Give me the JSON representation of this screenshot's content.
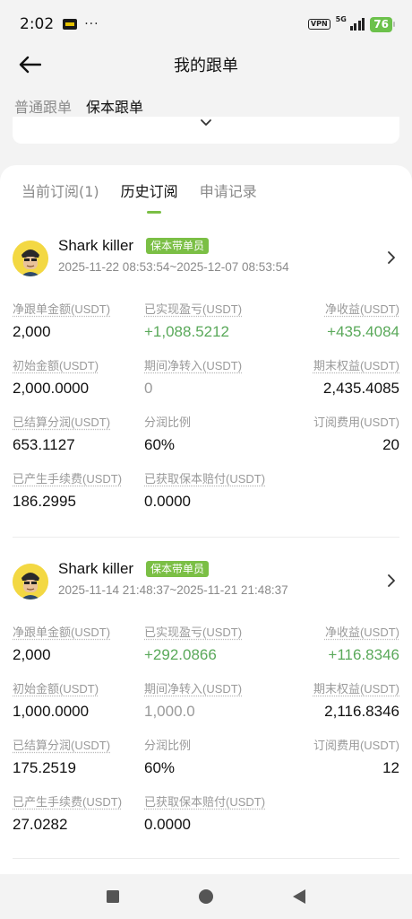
{
  "status_bar": {
    "time": "2:02",
    "dots": "···",
    "vpn": "VPN",
    "network": "5G",
    "battery": "76"
  },
  "header": {
    "title": "我的跟单"
  },
  "mode_tabs": [
    {
      "label": "普通跟单",
      "active": false
    },
    {
      "label": "保本跟单",
      "active": true
    }
  ],
  "sub_tabs": [
    {
      "label": "当前订阅(1)",
      "active": false
    },
    {
      "label": "历史订阅",
      "active": true
    },
    {
      "label": "申请记录",
      "active": false
    }
  ],
  "records": [
    {
      "name": "Shark killer",
      "badge": "保本带单员",
      "period": "2025-11-22 08:53:54~2025-12-07 08:53:54",
      "stats": {
        "net_follow_amount": {
          "label": "净跟单金额(USDT)",
          "value": "2,000"
        },
        "realized_pnl": {
          "label": "已实现盈亏(USDT)",
          "value": "+1,088.5212"
        },
        "net_profit": {
          "label": "净收益(USDT)",
          "value": "+435.4084"
        },
        "initial_amount": {
          "label": "初始金额(USDT)",
          "value": "2,000.0000"
        },
        "net_transfer": {
          "label": "期间净转入(USDT)",
          "value": "0"
        },
        "final_equity": {
          "label": "期末权益(USDT)",
          "value": "2,435.4085"
        },
        "settled_share": {
          "label": "已结算分润(USDT)",
          "value": "653.1127"
        },
        "share_ratio": {
          "label": "分润比例",
          "value": "60%"
        },
        "subscription_fee": {
          "label": "订阅费用(USDT)",
          "value": "20"
        },
        "fees": {
          "label": "已产生手续费(USDT)",
          "value": "186.2995"
        },
        "compensation": {
          "label": "已获取保本赔付(USDT)",
          "value": "0.0000"
        }
      }
    },
    {
      "name": "Shark killer",
      "badge": "保本带单员",
      "period": "2025-11-14 21:48:37~2025-11-21 21:48:37",
      "stats": {
        "net_follow_amount": {
          "label": "净跟单金额(USDT)",
          "value": "2,000"
        },
        "realized_pnl": {
          "label": "已实现盈亏(USDT)",
          "value": "+292.0866"
        },
        "net_profit": {
          "label": "净收益(USDT)",
          "value": "+116.8346"
        },
        "initial_amount": {
          "label": "初始金额(USDT)",
          "value": "1,000.0000"
        },
        "net_transfer": {
          "label": "期间净转入(USDT)",
          "value": "1,000.0"
        },
        "final_equity": {
          "label": "期末权益(USDT)",
          "value": "2,116.8346"
        },
        "settled_share": {
          "label": "已结算分润(USDT)",
          "value": "175.2519"
        },
        "share_ratio": {
          "label": "分润比例",
          "value": "60%"
        },
        "subscription_fee": {
          "label": "订阅费用(USDT)",
          "value": "12"
        },
        "fees": {
          "label": "已产生手续费(USDT)",
          "value": "27.0282"
        },
        "compensation": {
          "label": "已获取保本赔付(USDT)",
          "value": "0.0000"
        }
      }
    }
  ],
  "colors": {
    "accent_green": "#7bbf45",
    "profit_green": "#5aa95a",
    "muted_text": "#9a9a9a"
  }
}
